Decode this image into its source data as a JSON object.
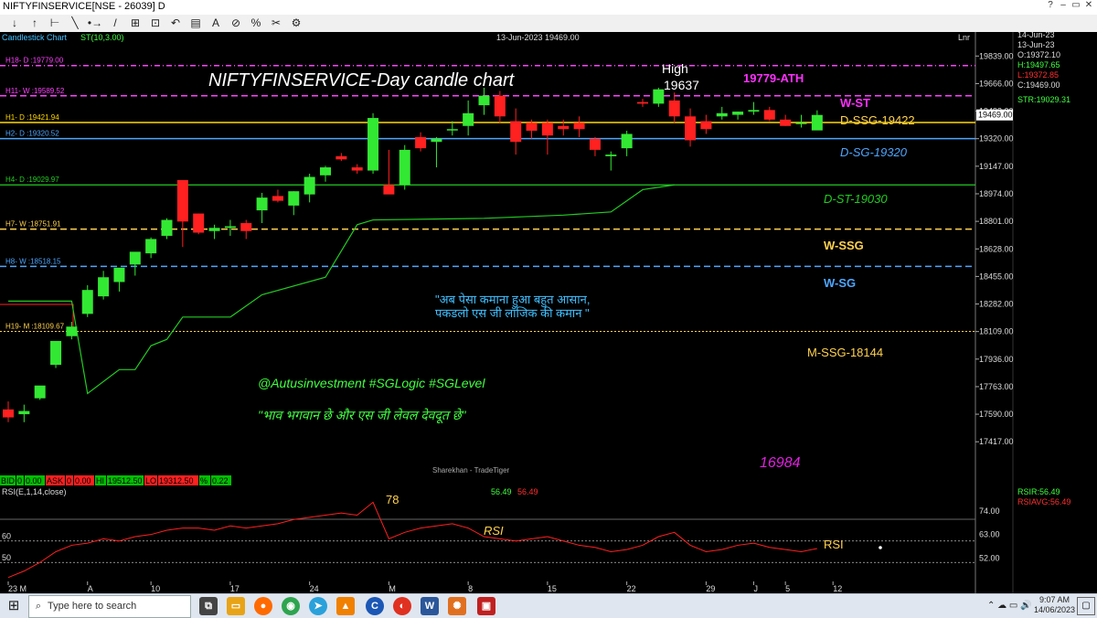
{
  "window": {
    "title": "NIFTYFINSERVICE[NSE - 26039] D",
    "buttons": [
      "?",
      "–",
      "▭",
      "✕"
    ]
  },
  "toolbar": {
    "items": [
      "↓",
      "↑",
      "⊢",
      "╲",
      "•→",
      "/",
      "⊞",
      "⊡",
      "↶",
      "▤",
      "A",
      "⊘",
      "%",
      "✂",
      "⚙"
    ]
  },
  "chart_header": {
    "chart_type_label": "Candlestick Chart",
    "indicator_label": "ST(10,3.00)",
    "date_value": "13-Jun-2023 19469.00",
    "scale_label": "Lnr"
  },
  "info_panel": {
    "date1": "14-Jun-23",
    "date2": "13-Jun-23",
    "open": "O:19372.10",
    "high": "H:19497.65",
    "low": "L:19372.85",
    "close": "C:19469.00",
    "str": "STR:19029.31"
  },
  "annotations": {
    "main_title": "NIFTYFINSERVICE-Day candle chart",
    "high_label": "High",
    "high_value": "19637",
    "ath": "19779-ATH",
    "w_st": "W-ST",
    "d_ssg": "D-SSG-19422",
    "d_sg": "D-SG-19320",
    "d_st": "D-ST-19030",
    "w_ssg": "W-SSG",
    "w_sg": "W-SG",
    "m_ssg": "M-SSG-18144",
    "quote1": "\"अब पेसा कमाना हुआ बहुत आसान,",
    "quote2": "पकडलो एस जी लॉजिक की कमान \"",
    "handle": "@Autusinvestment  #SGLogic  #SGLevel",
    "quote3": "\"भाव भगवान छे और एस जी लेवल देवदूत छे\"",
    "low_value": "16984",
    "watermark": "Sharekhan - TradeTiger",
    "rsi_peak": "78",
    "rsi_text": "RSI",
    "rsi_text2": "RSI"
  },
  "level_labels": [
    {
      "text": "H18- D :19779.00",
      "color": "#ff40ff",
      "dash": "6,3,1,3",
      "lw": 1.5
    },
    {
      "text": "H11- W :19589.52",
      "color": "#ff40ff",
      "dash": "7,4",
      "lw": 1.5
    },
    {
      "text": "H1- D :19421.94",
      "color": "#ffd700",
      "dash": "",
      "lw": 1.5
    },
    {
      "text": "H2- D :19320.52",
      "color": "#4da6ff",
      "dash": "",
      "lw": 1.5
    },
    {
      "text": "H4- D :19029.97",
      "color": "#22cc22",
      "dash": "",
      "lw": 1.2
    },
    {
      "text": "H7- W :18751.91",
      "color": "#ffd24d",
      "dash": "7,4",
      "lw": 1.5
    },
    {
      "text": "H8- W :18518.15",
      "color": "#4da6ff",
      "dash": "7,4",
      "lw": 1.5
    },
    {
      "text": "H19- M :18109.67",
      "color": "#ffd24d",
      "dash": "2,2",
      "lw": 1
    }
  ],
  "bid_bar": {
    "bid_label": "BID",
    "bid_qty": "0",
    "bid_val": "0.00",
    "ask_label": "ASK",
    "ask_qty": "0",
    "ask_val": "0.00",
    "hi_label": "HI",
    "hi_val": "19512.50",
    "lo_label": "LO",
    "lo_val": "19312.50",
    "pct_label": "%",
    "pct_val": "0.22"
  },
  "rsi_panel": {
    "label": "RSI(E,1,14,close)",
    "value1": "56.49",
    "value2": "56.49",
    "rsir": "RSIR:56.49",
    "rsiavg": "RSIAVG:56.49",
    "scale_labels": [
      "74.00",
      "63.00",
      "52.00"
    ],
    "left_labels": [
      "60",
      "50"
    ]
  },
  "x_axis_labels": [
    "23 M",
    "A",
    "10",
    "17",
    "24",
    "M",
    "8",
    "15",
    "22",
    "29",
    "J",
    "5",
    "12"
  ],
  "y_axis_labels": [
    "19839.00",
    "19666.00",
    "19493.00",
    "19469.00",
    "19320.00",
    "19147.00",
    "18974.00",
    "18801.00",
    "18628.00",
    "18455.00",
    "18282.00",
    "18109.00",
    "17936.00",
    "17763.00",
    "17590.00",
    "17417.00"
  ],
  "taskbar": {
    "search_placeholder": "Type here to search",
    "time": "9:07 AM",
    "date": "14/06/2023"
  },
  "chart_data": {
    "type": "candlestick",
    "title": "NIFTYFINSERVICE-Day candle chart",
    "ylim": [
      17246,
      19944
    ],
    "y_ticks": [
      19839,
      19666,
      19493,
      19320,
      19147,
      18974,
      18801,
      18628,
      18455,
      18282,
      18109,
      17936,
      17763,
      17590,
      17417
    ],
    "last_price": 19469,
    "candles": [
      {
        "o": 17620,
        "h": 17670,
        "l": 17540,
        "c": 17570
      },
      {
        "o": 17590,
        "h": 17650,
        "l": 17540,
        "c": 17610
      },
      {
        "o": 17690,
        "h": 17760,
        "l": 17680,
        "c": 17770
      },
      {
        "o": 17900,
        "h": 18020,
        "l": 17880,
        "c": 18050
      },
      {
        "o": 18080,
        "h": 18170,
        "l": 18060,
        "c": 18140
      },
      {
        "o": 18220,
        "h": 18400,
        "l": 18200,
        "c": 18370
      },
      {
        "o": 18330,
        "h": 18490,
        "l": 18310,
        "c": 18450
      },
      {
        "o": 18420,
        "h": 18500,
        "l": 18360,
        "c": 18510
      },
      {
        "o": 18530,
        "h": 18580,
        "l": 18460,
        "c": 18610
      },
      {
        "o": 18600,
        "h": 18700,
        "l": 18570,
        "c": 18690
      },
      {
        "o": 18710,
        "h": 18820,
        "l": 18690,
        "c": 18810
      },
      {
        "o": 19060,
        "h": 19060,
        "l": 18640,
        "c": 18800
      },
      {
        "o": 18850,
        "h": 18850,
        "l": 18720,
        "c": 18730
      },
      {
        "o": 18740,
        "h": 18780,
        "l": 18690,
        "c": 18760
      },
      {
        "o": 18760,
        "h": 18810,
        "l": 18710,
        "c": 18770
      },
      {
        "o": 18790,
        "h": 18810,
        "l": 18690,
        "c": 18740
      },
      {
        "o": 18870,
        "h": 18980,
        "l": 18790,
        "c": 18950
      },
      {
        "o": 18960,
        "h": 19000,
        "l": 18920,
        "c": 18930
      },
      {
        "o": 18900,
        "h": 18990,
        "l": 18840,
        "c": 18990
      },
      {
        "o": 18970,
        "h": 19100,
        "l": 18920,
        "c": 19080
      },
      {
        "o": 19090,
        "h": 19150,
        "l": 19050,
        "c": 19140
      },
      {
        "o": 19210,
        "h": 19230,
        "l": 19180,
        "c": 19190
      },
      {
        "o": 19140,
        "h": 19160,
        "l": 19100,
        "c": 19120
      },
      {
        "o": 19120,
        "h": 19480,
        "l": 19100,
        "c": 19450
      },
      {
        "o": 19030,
        "h": 19250,
        "l": 19000,
        "c": 18970
      },
      {
        "o": 19030,
        "h": 19280,
        "l": 19000,
        "c": 19250
      },
      {
        "o": 19330,
        "h": 19360,
        "l": 19240,
        "c": 19260
      },
      {
        "o": 19300,
        "h": 19330,
        "l": 19140,
        "c": 19320
      },
      {
        "o": 19380,
        "h": 19430,
        "l": 19340,
        "c": 19380
      },
      {
        "o": 19400,
        "h": 19560,
        "l": 19340,
        "c": 19480
      },
      {
        "o": 19530,
        "h": 19640,
        "l": 19470,
        "c": 19590
      },
      {
        "o": 19590,
        "h": 19620,
        "l": 19420,
        "c": 19460
      },
      {
        "o": 19430,
        "h": 19510,
        "l": 19220,
        "c": 19300
      },
      {
        "o": 19420,
        "h": 19440,
        "l": 19320,
        "c": 19370
      },
      {
        "o": 19420,
        "h": 19440,
        "l": 19220,
        "c": 19340
      },
      {
        "o": 19400,
        "h": 19440,
        "l": 19340,
        "c": 19380
      },
      {
        "o": 19420,
        "h": 19460,
        "l": 19330,
        "c": 19380
      },
      {
        "o": 19320,
        "h": 19330,
        "l": 19210,
        "c": 19250
      },
      {
        "o": 19210,
        "h": 19240,
        "l": 19120,
        "c": 19220
      },
      {
        "o": 19260,
        "h": 19370,
        "l": 19210,
        "c": 19350
      },
      {
        "o": 19550,
        "h": 19570,
        "l": 19520,
        "c": 19540
      },
      {
        "o": 19540,
        "h": 19640,
        "l": 19520,
        "c": 19630
      },
      {
        "o": 19560,
        "h": 19610,
        "l": 19420,
        "c": 19460
      },
      {
        "o": 19460,
        "h": 19510,
        "l": 19270,
        "c": 19310
      },
      {
        "o": 19430,
        "h": 19470,
        "l": 19350,
        "c": 19380
      },
      {
        "o": 19460,
        "h": 19520,
        "l": 19440,
        "c": 19480
      },
      {
        "o": 19470,
        "h": 19490,
        "l": 19440,
        "c": 19490
      },
      {
        "o": 19490,
        "h": 19550,
        "l": 19470,
        "c": 19500
      },
      {
        "o": 19500,
        "h": 19520,
        "l": 19430,
        "c": 19440
      },
      {
        "o": 19440,
        "h": 19470,
        "l": 19400,
        "c": 19400
      },
      {
        "o": 19420,
        "h": 19470,
        "l": 19390,
        "c": 19420
      },
      {
        "o": 19372,
        "h": 19498,
        "l": 19373,
        "c": 19469
      }
    ],
    "supertrend": [
      {
        "x": 0,
        "y": 18300
      },
      {
        "x": 4,
        "y": 18300
      },
      {
        "x": 5,
        "y": 17720
      },
      {
        "x": 7,
        "y": 17870
      },
      {
        "x": 8,
        "y": 17870
      },
      {
        "x": 9,
        "y": 18020
      },
      {
        "x": 10,
        "y": 18060
      },
      {
        "x": 11,
        "y": 18200
      },
      {
        "x": 14,
        "y": 18200
      },
      {
        "x": 16,
        "y": 18340
      },
      {
        "x": 20,
        "y": 18450
      },
      {
        "x": 22,
        "y": 18780
      },
      {
        "x": 23,
        "y": 18810
      },
      {
        "x": 30,
        "y": 18820
      },
      {
        "x": 35,
        "y": 18840
      },
      {
        "x": 38,
        "y": 18860
      },
      {
        "x": 40,
        "y": 19000
      },
      {
        "x": 42,
        "y": 19030
      }
    ],
    "rsi": {
      "ylim": [
        45,
        82
      ],
      "levels": [
        60,
        50
      ],
      "values": [
        43,
        46,
        50,
        55,
        58,
        59,
        61,
        60,
        62,
        63,
        65,
        66,
        66,
        65,
        67,
        66,
        67,
        68,
        70,
        71,
        72,
        73,
        72,
        78,
        61,
        64,
        66,
        67,
        68,
        66,
        62,
        61,
        60,
        61,
        62,
        60,
        58,
        57,
        55,
        56,
        58,
        62,
        64,
        58,
        55,
        56,
        58,
        59,
        57,
        56,
        55,
        56.49
      ]
    }
  }
}
